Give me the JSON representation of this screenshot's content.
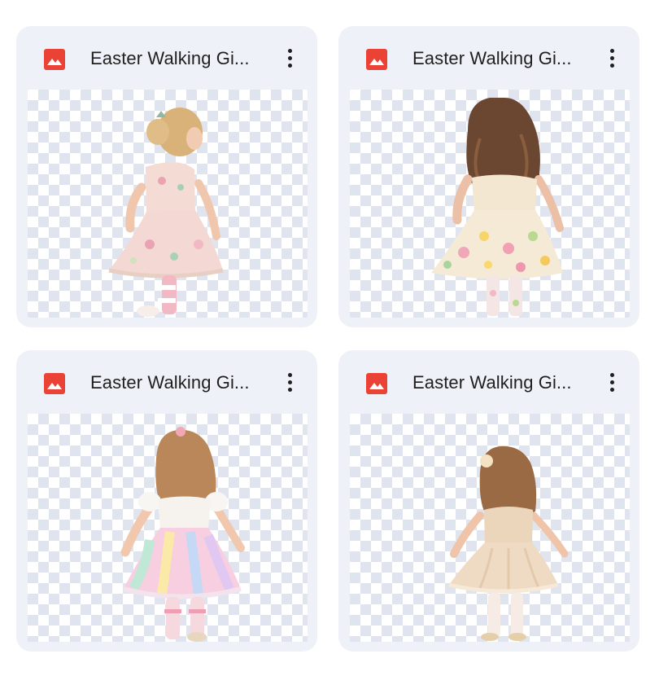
{
  "files": [
    {
      "title": "Easter Walking Gi...",
      "icon": "image-file-icon",
      "icon_color": "#ea4335",
      "dress": "floral pink"
    },
    {
      "title": "Easter Walking Gi...",
      "icon": "image-file-icon",
      "icon_color": "#ea4335",
      "dress": "floral cream"
    },
    {
      "title": "Easter Walking Gi...",
      "icon": "image-file-icon",
      "icon_color": "#ea4335",
      "dress": "pastel rainbow"
    },
    {
      "title": "Easter Walking Gi...",
      "icon": "image-file-icon",
      "icon_color": "#ea4335",
      "dress": "beige"
    }
  ]
}
